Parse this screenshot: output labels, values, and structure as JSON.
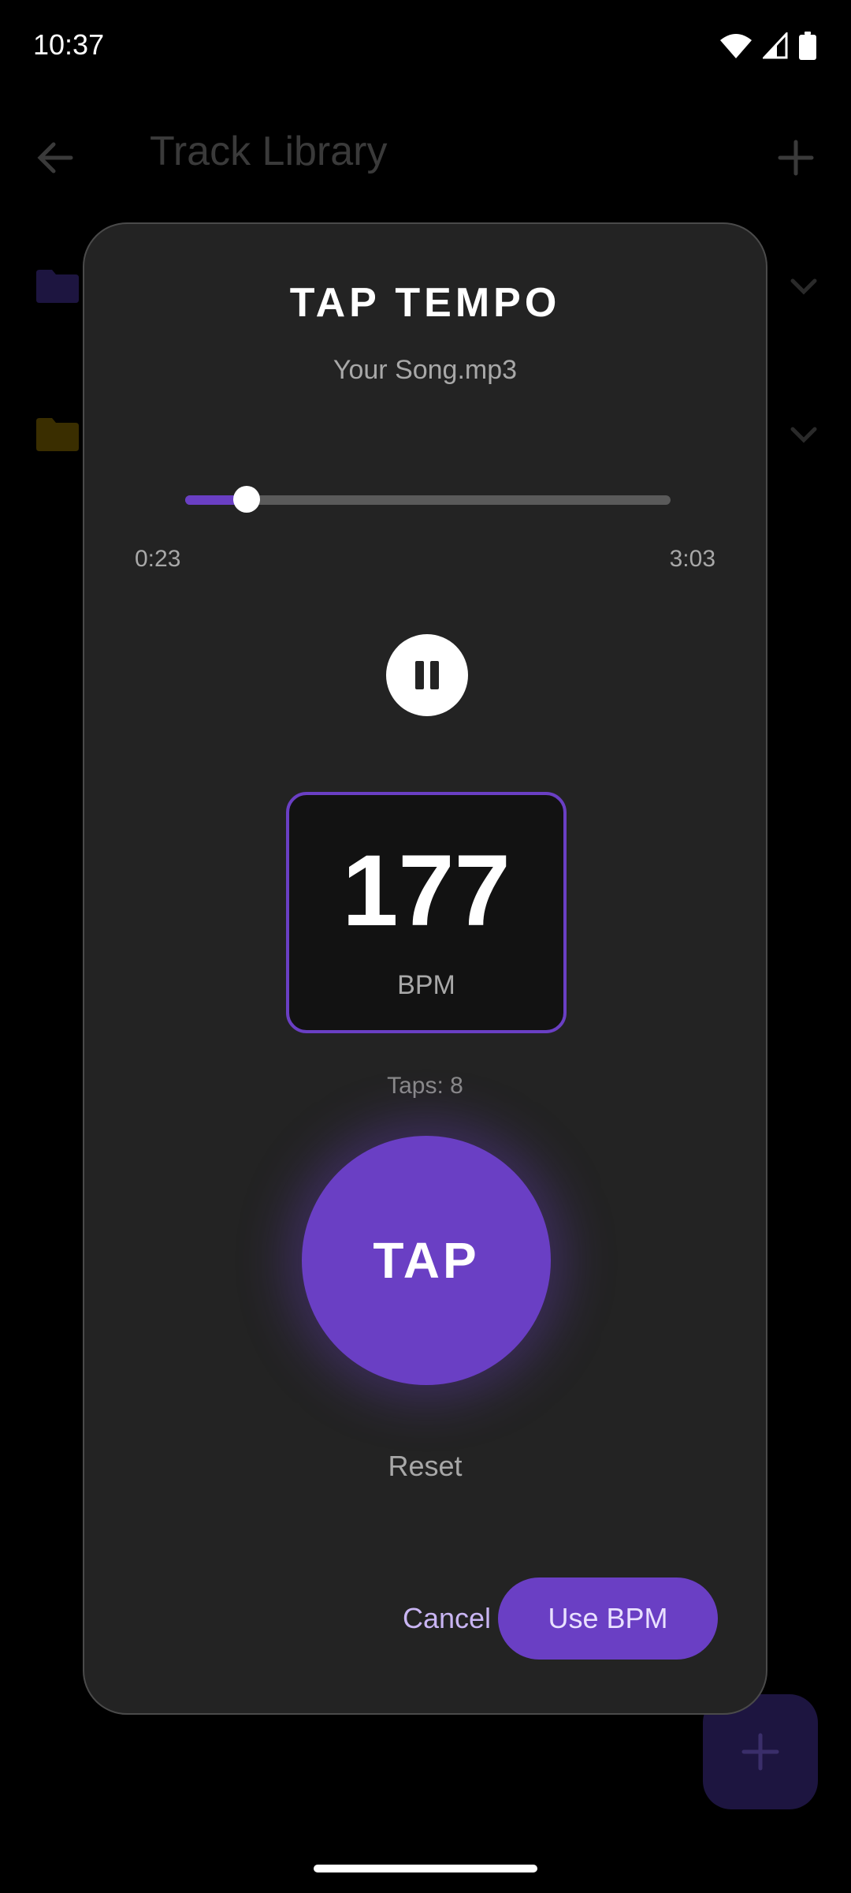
{
  "status_bar": {
    "time": "10:37",
    "icons": [
      "wifi-icon",
      "signal-icon",
      "battery-icon"
    ]
  },
  "background_app": {
    "title": "Track Library",
    "rows": [
      {
        "icon": "folder-icon",
        "color": "#1d1540"
      },
      {
        "icon": "folder-icon",
        "color": "#3a2e00"
      }
    ]
  },
  "dialog": {
    "title": "TAP TEMPO",
    "subtitle": "Your Song.mp3",
    "playback": {
      "position": "0:23",
      "duration": "3:03",
      "progress_fraction": 0.126,
      "state_icon": "pause-icon"
    },
    "bpm": {
      "value": "177",
      "label": "BPM"
    },
    "taps_text": "Taps: 8",
    "tap_label": "TAP",
    "reset_label": "Reset",
    "cancel_label": "Cancel",
    "use_bpm_label": "Use BPM"
  },
  "colors": {
    "accent": "#6a3fc4",
    "dialog_bg": "#232323",
    "secondary_text": "#a8a8a8",
    "cancel_text": "#c9b5f3"
  }
}
